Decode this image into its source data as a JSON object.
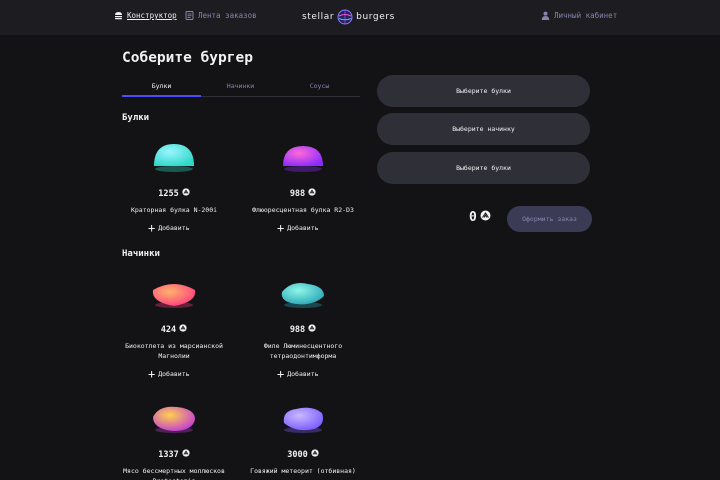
{
  "header": {
    "constructor_label": "Конструктор",
    "feed_label": "Лента заказов",
    "logo_left": "stellar",
    "logo_right": "burgers",
    "account_label": "Личный кабинет"
  },
  "page": {
    "title": "Соберите бургер",
    "tabs": [
      {
        "label": "Булки",
        "active": true
      },
      {
        "label": "Начинки",
        "active": false
      },
      {
        "label": "Соусы",
        "active": false
      }
    ]
  },
  "sections": {
    "buns_title": "Булки",
    "fillings_title": "Начинки"
  },
  "ingredients": [
    {
      "price": "1255",
      "name": "Краторная булка N-200i",
      "add": "Добавить",
      "color_a": "#9af5ff",
      "color_b": "#2fd8c8"
    },
    {
      "price": "988",
      "name": "Флюоресцентная булка R2-D3",
      "add": "Добавить",
      "color_a": "#ff6ad5",
      "color_b": "#8a2bff"
    },
    {
      "price": "424",
      "name": "Биокотлета из марсианской Магнолии",
      "add": "Добавить",
      "color_a": "#ffb36b",
      "color_b": "#ff3d7f"
    },
    {
      "price": "988",
      "name": "Филе Люминесцентного тетраодонтимформа",
      "add": "Добавить",
      "color_a": "#8ff7e8",
      "color_b": "#2aa6b8"
    },
    {
      "price": "1337",
      "name": "Мясо бессмертных моллюсков Protostomia",
      "add": "Добавить",
      "color_a": "#ffd04a",
      "color_b": "#c23bd6"
    },
    {
      "price": "3000",
      "name": "Говяжий метеорит (отбивная)",
      "add": "Добавить",
      "color_a": "#c9b8ff",
      "color_b": "#7a5cff"
    }
  ],
  "constructor": {
    "slot_top": "Выберите булки",
    "slot_middle": "Выберите начинку",
    "slot_bottom": "Выберите булки",
    "total": "0",
    "order_button": "Оформить заказ"
  },
  "colors": {
    "background": "#131316",
    "header": "#1c1c21",
    "accent": "#4c4cff",
    "muted": "#8585ad"
  }
}
